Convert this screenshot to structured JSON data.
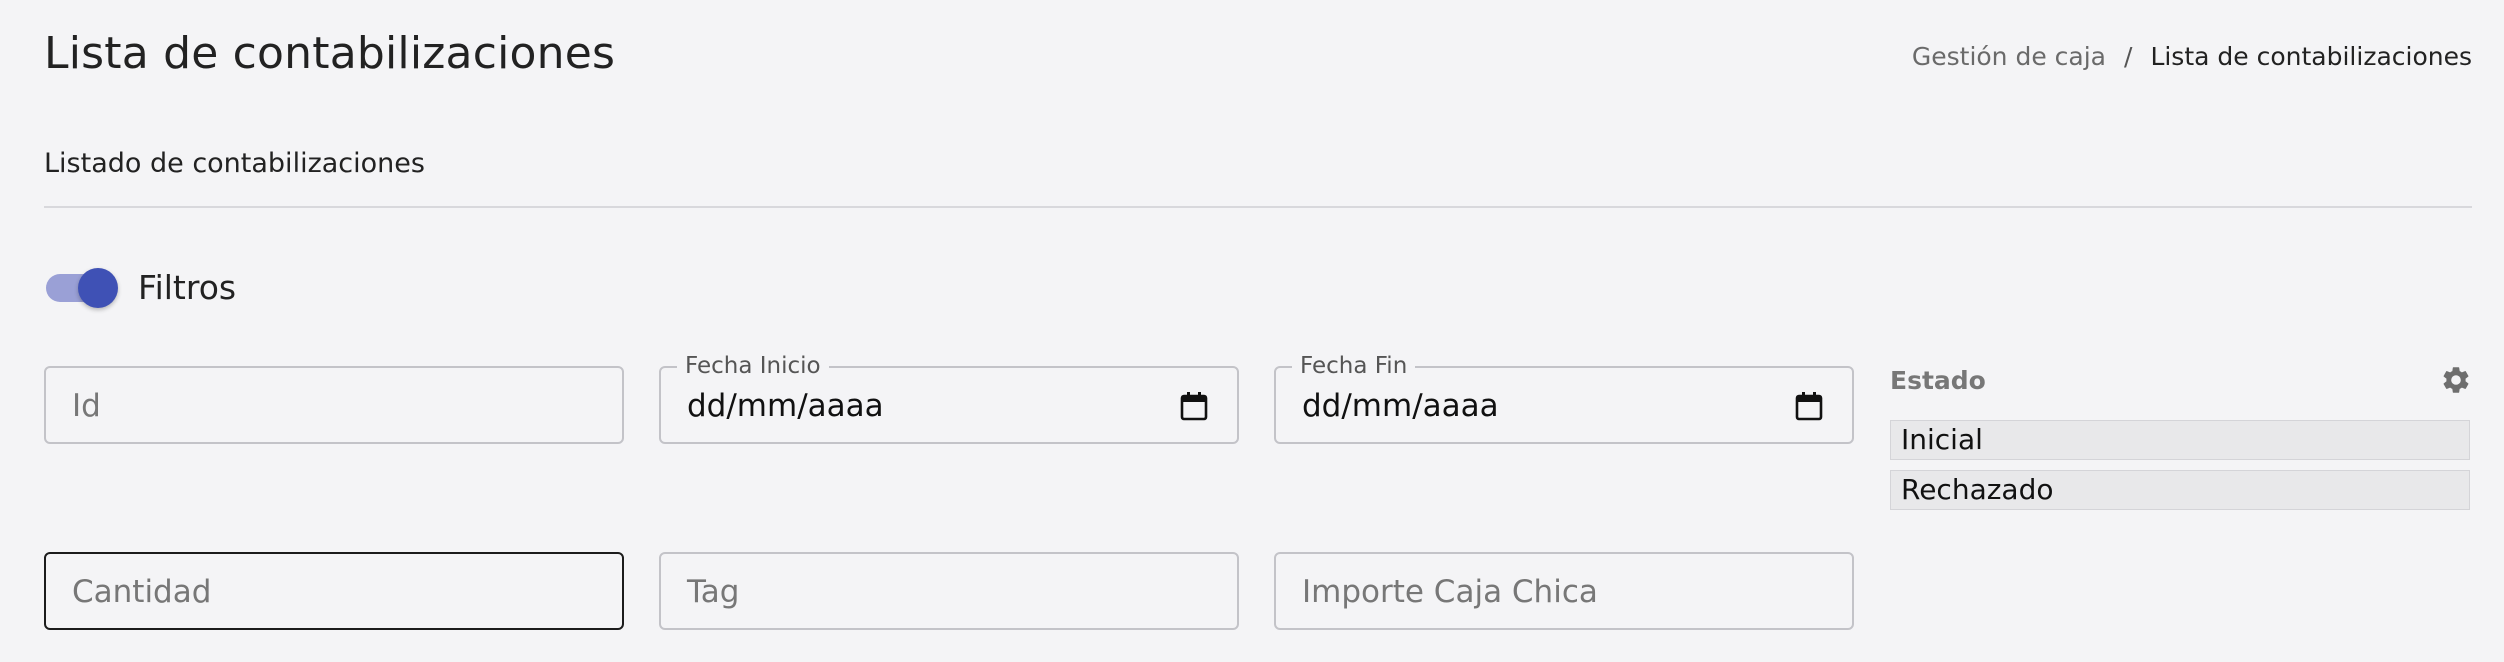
{
  "header": {
    "title": "Lista de contabilizaciones",
    "breadcrumb": {
      "parent": "Gestión de caja",
      "separator": "/",
      "current": "Lista de contabilizaciones"
    }
  },
  "section": {
    "title": "Listado de contabilizaciones"
  },
  "filters": {
    "toggle_label": "Filtros",
    "toggle_on": true,
    "id_placeholder": "Id",
    "fecha_inicio_label": "Fecha Inicio",
    "fecha_inicio_value": "dd/mm/aaaa",
    "fecha_fin_label": "Fecha Fin",
    "fecha_fin_value": "dd/mm/aaaa",
    "cantidad_placeholder": "Cantidad",
    "tag_placeholder": "Tag",
    "importe_placeholder": "Importe Caja Chica",
    "estado": {
      "label": "Estado",
      "options": [
        "Inicial",
        "Rechazado"
      ]
    }
  },
  "colors": {
    "accent": "#3f51b5",
    "toggle_track": "#9aa0d6",
    "background": "#f4f4f6"
  },
  "icons": {
    "calendar": "calendar-icon",
    "settings": "gear-icon"
  }
}
